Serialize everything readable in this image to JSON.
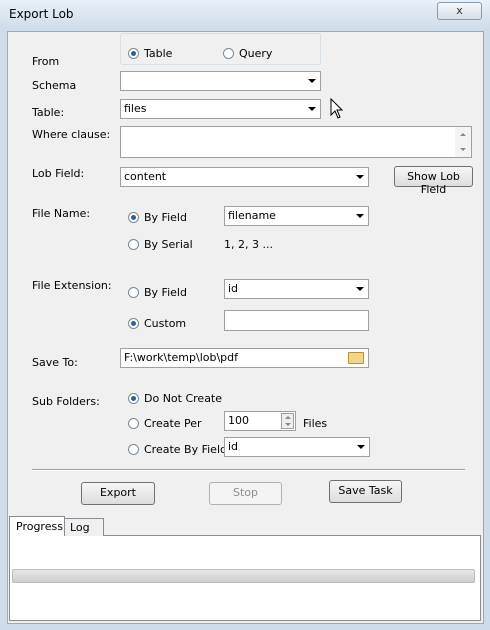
{
  "window": {
    "title": "Export Lob",
    "close_symbol": "x"
  },
  "from": {
    "label": "From",
    "options": [
      "Table",
      "Query"
    ],
    "selected": "Table"
  },
  "schema": {
    "label": "Schema",
    "value": ""
  },
  "table": {
    "label": "Table:",
    "value": "files"
  },
  "where": {
    "label": "Where clause:",
    "value": ""
  },
  "lob_field": {
    "label": "Lob Field:",
    "value": "content",
    "show_button": "Show Lob Field"
  },
  "file_name": {
    "label": "File Name:",
    "by_field_label": "By Field",
    "by_field_value": "filename",
    "by_serial_label": "By Serial",
    "serial_preview": "1, 2, 3 ...",
    "selected": "By Field"
  },
  "file_extension": {
    "label": "File Extension:",
    "by_field_label": "By Field",
    "by_field_value": "id",
    "custom_label": "Custom",
    "custom_value": "",
    "selected": "Custom"
  },
  "save_to": {
    "label": "Save To:",
    "value": "F:\\work\\temp\\lob\\pdf"
  },
  "sub_folders": {
    "label": "Sub Folders:",
    "do_not_create_label": "Do Not Create",
    "create_per_label": "Create Per",
    "create_per_value": "100",
    "files_suffix": "Files",
    "create_by_field_label": "Create By Field",
    "create_by_field_value": "id",
    "selected": "Do Not Create"
  },
  "buttons": {
    "export": "Export",
    "stop": "Stop",
    "save_task": "Save Task"
  },
  "tabs": [
    "Progress",
    "Log"
  ],
  "active_tab": "Progress",
  "progress_value": 0
}
